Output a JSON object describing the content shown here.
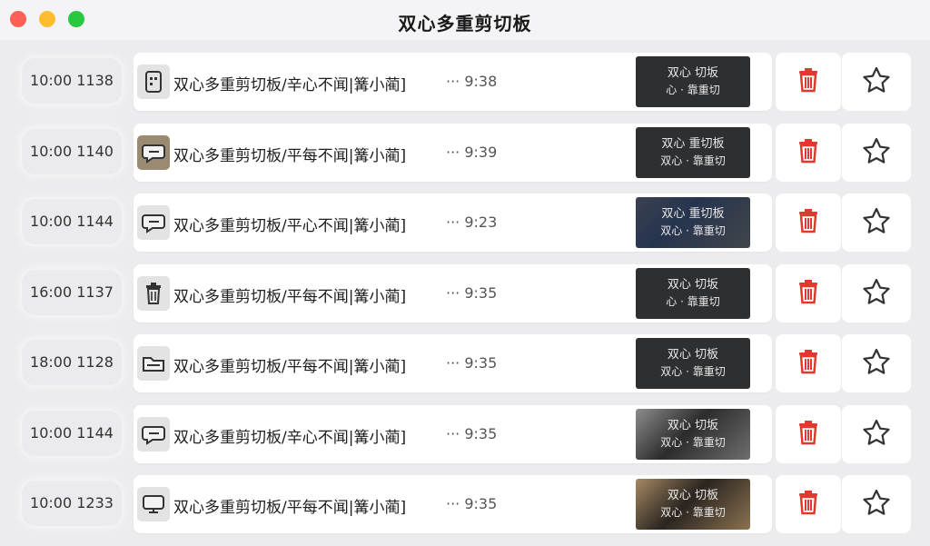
{
  "window": {
    "title": "双心多重剪切板"
  },
  "colors": {
    "delete": "#e03a2f",
    "star": "#333333",
    "card": "#ffffff",
    "background": "#ececee"
  },
  "rows": [
    {
      "time": "10:00 1138",
      "icon": "document-icon",
      "text": "双心多重剪切板/​辛心不闻|篝小蔺]",
      "ellipsis": "···",
      "clip_time": "9:38",
      "thumb": {
        "line1": "双心 切坂",
        "line2": "心 · 靠重切",
        "style": "dark"
      }
    },
    {
      "time": "10:00 1140",
      "icon": "chat-bubble-icon",
      "text": "双心多重剪切板/​平每不闻|篝小蔺]",
      "ellipsis": "···",
      "clip_time": "9:39",
      "thumb": {
        "line1": "双心 重切板",
        "line2": "双心 · 靠重切",
        "style": "dark"
      }
    },
    {
      "time": "10:00 1144",
      "icon": "chat-bubble-icon",
      "text": "双心多重剪切板/​平心不闻|篝小蔺]",
      "ellipsis": "···",
      "clip_time": "9:23",
      "thumb": {
        "line1": "双心 重切板",
        "line2": "双心 · 靠重切",
        "style": "keyboard"
      }
    },
    {
      "time": "16:00 1137",
      "icon": "trash-icon",
      "text": "双心多重剪切板/​平每不闻|篝小蔺]",
      "ellipsis": "···",
      "clip_time": "9:35",
      "thumb": {
        "line1": "双心 切坂",
        "line2": "心 · 靠重切",
        "style": "dark"
      }
    },
    {
      "time": "18:00 1128",
      "icon": "folder-icon",
      "text": "双心多重剪切板/​平每不闻|篝小蔺]",
      "ellipsis": "···",
      "clip_time": "9:35",
      "thumb": {
        "line1": "双心 切板",
        "line2": "双心 · 靠重切",
        "style": "dark"
      }
    },
    {
      "time": "10:00 1144",
      "icon": "chat-bubble-icon",
      "text": "双心多重剪切板/​辛心不闻|篝小蔺]",
      "ellipsis": "···",
      "clip_time": "9:35",
      "thumb": {
        "line1": "双心 切坂",
        "line2": "双心 · 靠重切",
        "style": "hand"
      }
    },
    {
      "time": "10:00 1233",
      "icon": "monitor-icon",
      "text": "双心多重剪切板/​平每不闻|篝小蔺]",
      "ellipsis": "···",
      "clip_time": "9:35",
      "thumb": {
        "line1": "双心 切板",
        "line2": "双心 · 靠重切",
        "style": "hand-brown"
      }
    }
  ]
}
